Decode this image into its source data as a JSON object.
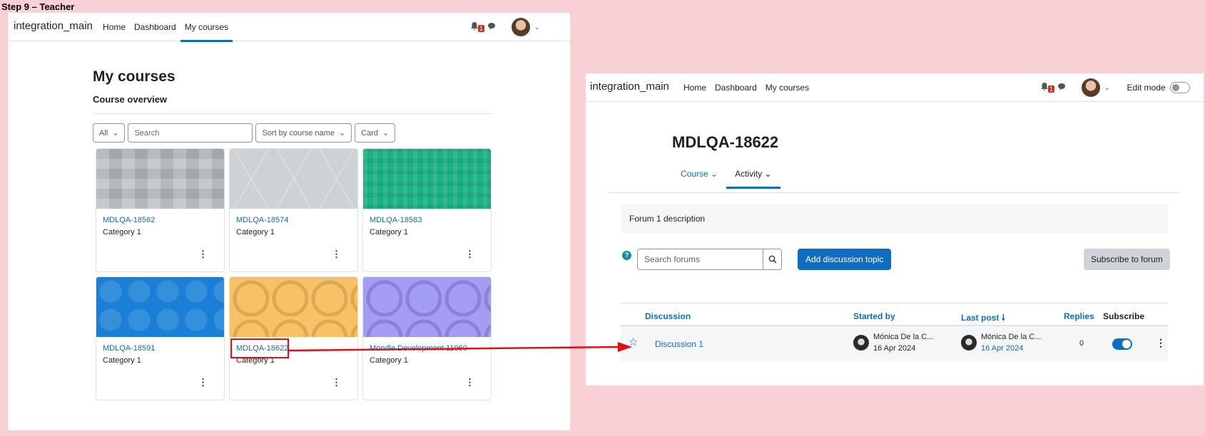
{
  "step_label": "Step 9 – Teacher",
  "colors": {
    "accent": "#0f6cbf",
    "annotation": "#e0101a",
    "page_bg": "#f8d0d6"
  },
  "window1": {
    "nav": {
      "brand": "integration_main",
      "links": [
        "Home",
        "Dashboard",
        "My courses"
      ],
      "active": "My courses",
      "notification_count": "1"
    },
    "title": "My courses",
    "subtitle": "Course overview",
    "filters": {
      "all": "All",
      "search_placeholder": "Search",
      "sort": "Sort by course name",
      "view": "Card"
    },
    "courses": [
      {
        "name": "MDLQA-18562",
        "category": "Category 1",
        "image": "grey-squares"
      },
      {
        "name": "MDLQA-18574",
        "category": "Category 1",
        "image": "grey-triangles"
      },
      {
        "name": "MDLQA-18583",
        "category": "Category 1",
        "image": "green-plaid"
      },
      {
        "name": "MDLQA-18591",
        "category": "Category 1",
        "image": "blue-octagons"
      },
      {
        "name": "MDLQA-18622",
        "category": "Category 1",
        "image": "orange-circles"
      },
      {
        "name": "Moodle Development 11060",
        "category": "Category 1",
        "image": "purple-circles"
      }
    ],
    "menu_glyph": "⋮"
  },
  "window2": {
    "nav": {
      "brand": "integration_main",
      "links": [
        "Home",
        "Dashboard",
        "My courses"
      ],
      "notification_count": "1",
      "edit_mode_label": "Edit mode"
    },
    "title": "MDLQA-18622",
    "tabs": [
      "Course",
      "Activity"
    ],
    "active_tab": "Activity",
    "description": "Forum 1 description",
    "search_placeholder": "Search forums",
    "add_button": "Add discussion topic",
    "subscribe_button": "Subscribe to forum",
    "table": {
      "headers": {
        "discussion": "Discussion",
        "started_by": "Started by",
        "last_post": "Last post",
        "replies": "Replies",
        "subscribe": "Subscribe"
      },
      "rows": [
        {
          "discussion": "Discussion 1",
          "started_by": {
            "name": "Mónica De la C...",
            "date": "16 Apr 2024"
          },
          "last_post": {
            "name": "Mónica De la C...",
            "date": "16 Apr 2024"
          },
          "replies": "0",
          "subscribed": true
        }
      ]
    }
  }
}
